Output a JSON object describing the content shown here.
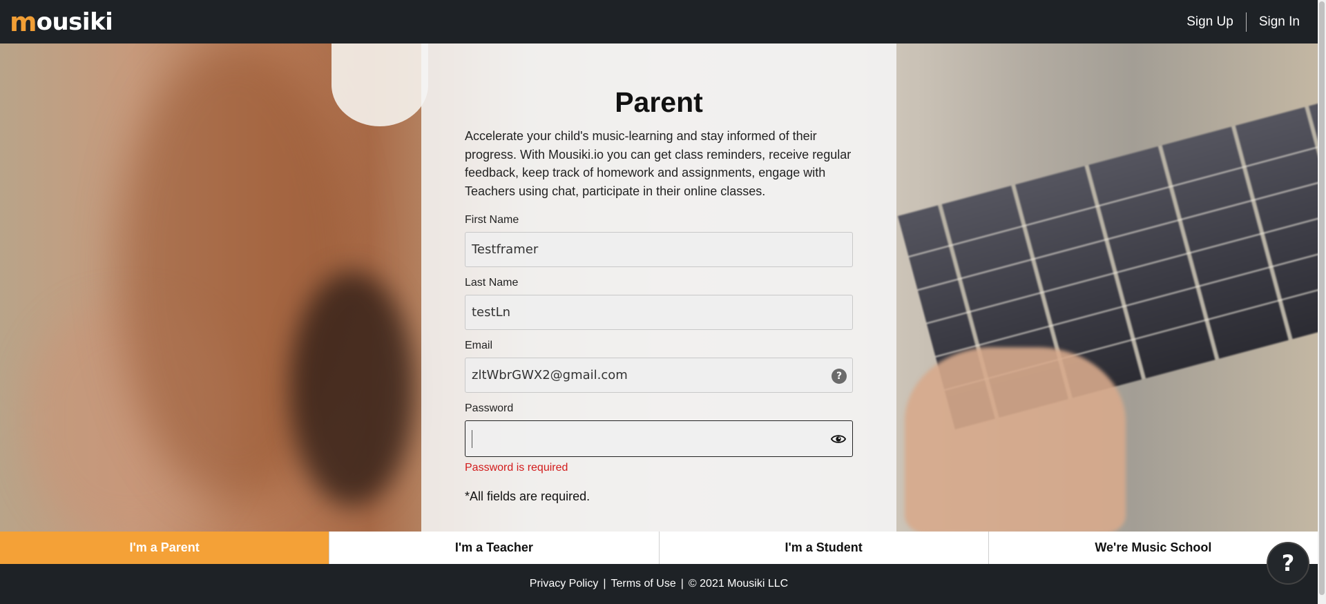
{
  "header": {
    "logo_m": "m",
    "logo_rest": "ousiki",
    "sign_up": "Sign Up",
    "sign_in": "Sign In"
  },
  "form": {
    "title": "Parent",
    "intro": "Accelerate your child's music-learning and stay informed of their progress. With Mousiki.io you can get class reminders, receive regular feedback, keep track of homework and assignments, engage with Teachers using chat, participate in their online classes.",
    "first_name": {
      "label": "First Name",
      "value": "Testframer"
    },
    "last_name": {
      "label": "Last Name",
      "value": "testLn"
    },
    "email": {
      "label": "Email",
      "value": "zltWbrGWX2@gmail.com",
      "help_icon": "?"
    },
    "password": {
      "label": "Password",
      "value": "",
      "error": "Password is required"
    },
    "required_note": "*All fields are required."
  },
  "tabs": [
    {
      "label": "I'm a Parent",
      "active": true
    },
    {
      "label": "I'm a Teacher",
      "active": false
    },
    {
      "label": "I'm a Student",
      "active": false
    },
    {
      "label": "We're Music School",
      "active": false
    }
  ],
  "footer": {
    "privacy": "Privacy Policy",
    "separator": "|",
    "terms": "Terms of Use",
    "copyright": "© 2021 Mousiki LLC"
  },
  "fab": {
    "label": "?"
  },
  "colors": {
    "accent": "#f4a137",
    "header_bg": "#1e2226",
    "error": "#d21b1b"
  }
}
